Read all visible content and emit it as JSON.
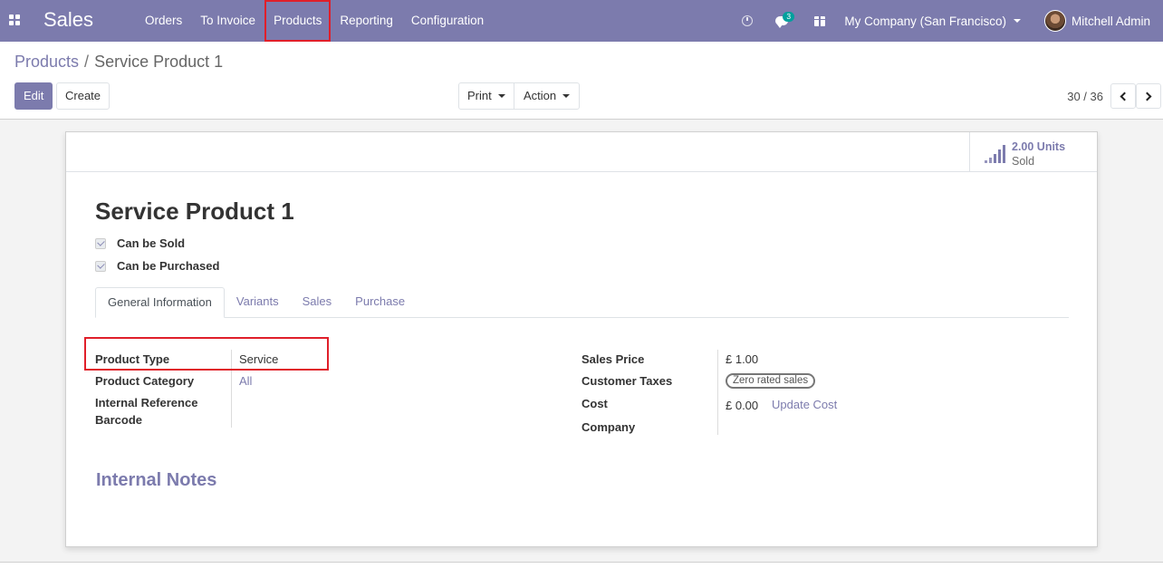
{
  "navbar": {
    "app_name": "Sales",
    "menu": [
      "Orders",
      "To Invoice",
      "Products",
      "Reporting",
      "Configuration"
    ],
    "highlighted_menu": "Products",
    "messages_count": "3",
    "company": "My Company (San Francisco)",
    "user": "Mitchell Admin"
  },
  "breadcrumb": {
    "parent": "Products",
    "separator": "/",
    "current": "Service Product 1"
  },
  "controls": {
    "edit": "Edit",
    "create": "Create",
    "print": "Print",
    "action": "Action",
    "pager": "30 / 36"
  },
  "smart_button": {
    "value": "2.00 Units",
    "label": "Sold"
  },
  "product": {
    "name": "Service Product 1",
    "checkboxes": [
      {
        "label": "Can be Sold",
        "checked": true
      },
      {
        "label": "Can be Purchased",
        "checked": true
      }
    ]
  },
  "tabs": [
    "General Information",
    "Variants",
    "Sales",
    "Purchase"
  ],
  "active_tab": "General Information",
  "left_fields": {
    "product_type_label": "Product Type",
    "product_type_value": "Service",
    "category_label": "Product Category",
    "category_value": "All",
    "internal_ref_label": "Internal Reference",
    "barcode_label": "Barcode"
  },
  "right_fields": {
    "sales_price_label": "Sales Price",
    "sales_price_value": "£ 1.00",
    "customer_taxes_label": "Customer Taxes",
    "customer_taxes_tag": "Zero rated sales",
    "cost_label": "Cost",
    "cost_value": "£ 0.00",
    "update_cost": "Update Cost",
    "company_label": "Company"
  },
  "internal_notes_title": "Internal Notes",
  "colors": {
    "primary": "#7c7bad",
    "highlight": "#e01f2a",
    "badge": "#00a09d"
  }
}
